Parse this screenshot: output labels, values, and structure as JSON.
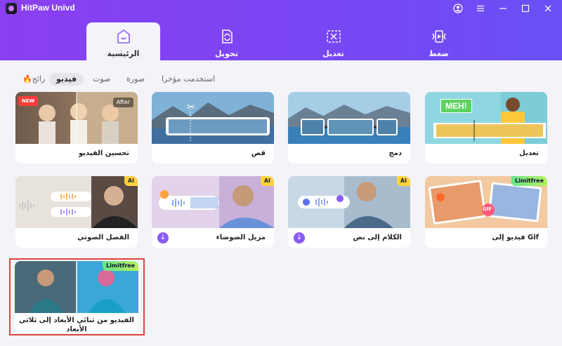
{
  "app": {
    "title": "HitPaw Univd"
  },
  "window_controls": {
    "account": "◯",
    "settings": "☰",
    "minimize": "—",
    "maximize": "☐",
    "close": "✕"
  },
  "main_tabs": [
    {
      "label": "الرئيسية",
      "icon": "home-icon",
      "active": true
    },
    {
      "label": "تحويل",
      "icon": "convert-icon",
      "active": false
    },
    {
      "label": "تعديل",
      "icon": "edit-icon",
      "active": false
    },
    {
      "label": "ضغط",
      "icon": "compress-icon",
      "active": false
    }
  ],
  "filters": {
    "recent": "استخدمت مؤخرا",
    "image": "صورة",
    "audio": "صوت",
    "video": "فيديو",
    "trending": "رائج"
  },
  "cards": {
    "enhance": {
      "label": "تحسين الفيديو",
      "badge": "NEW",
      "thumb_badge": "After"
    },
    "cut": {
      "label": "قص"
    },
    "merge": {
      "label": "دمج"
    },
    "edit": {
      "label": "تعديل",
      "thumb_text": "MEH!"
    },
    "vocal": {
      "label": "الفصل الصوتي",
      "badge": "AI"
    },
    "denoise": {
      "label": "مزيل الضوضاء",
      "badge": "AI"
    },
    "speech": {
      "label": "الكلام إلى نص",
      "badge": "AI"
    },
    "gif": {
      "label": "فيديو إلى Gif",
      "badge": "Limitfree",
      "thumb_text": "GIF"
    },
    "to3d": {
      "label": "الفيديو من ثنائي الأبعاد إلى ثلاثي الأبعاد",
      "badge": "Limitfree"
    }
  },
  "colors": {
    "accent": "#7b45f3",
    "selection": "#e0443a"
  }
}
